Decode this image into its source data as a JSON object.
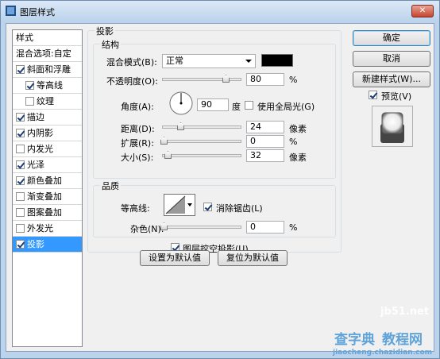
{
  "window": {
    "title": "图层样式",
    "close_glyph": "✕"
  },
  "stylelist": {
    "header": "样式",
    "blend_options": "混合选项:自定",
    "items": [
      {
        "label": "斜面和浮雕",
        "checked": true
      },
      {
        "label": "等高线",
        "checked": true
      },
      {
        "label": "纹理",
        "checked": false
      },
      {
        "label": "描边",
        "checked": true
      },
      {
        "label": "内阴影",
        "checked": true
      },
      {
        "label": "内发光",
        "checked": false
      },
      {
        "label": "光泽",
        "checked": true
      },
      {
        "label": "颜色叠加",
        "checked": true
      },
      {
        "label": "渐变叠加",
        "checked": false
      },
      {
        "label": "图案叠加",
        "checked": false
      },
      {
        "label": "外发光",
        "checked": false
      },
      {
        "label": "投影",
        "checked": true,
        "selected": true
      }
    ]
  },
  "shadow": {
    "group_title": "投影",
    "structure": {
      "title": "结构",
      "blend_mode_label": "混合模式(B):",
      "blend_mode_value": "正常",
      "shadow_color": "#000000",
      "opacity_label": "不透明度(O):",
      "opacity_value": "80",
      "opacity_level": 0.8,
      "opacity_unit": "%",
      "angle_label": "角度(A):",
      "angle_value": "90",
      "angle_unit": "度",
      "global_light_label": "使用全局光(G)",
      "global_light_checked": false,
      "distance_label": "距离(D):",
      "distance_value": "24",
      "distance_unit": "像素",
      "spread_label": "扩展(R):",
      "spread_value": "0",
      "spread_unit": "%",
      "size_label": "大小(S):",
      "size_value": "32",
      "size_unit": "像素"
    },
    "quality": {
      "title": "品质",
      "contour_label": "等高线:",
      "antialias_label": "消除锯齿(L)",
      "antialias_checked": true,
      "noise_label": "杂色(N):",
      "noise_value": "0",
      "noise_unit": "%"
    },
    "knockout_label": "图层挖空投影(U)",
    "knockout_checked": true,
    "make_default_label": "设置为默认值",
    "reset_default_label": "复位为默认值"
  },
  "actions": {
    "ok_label": "确定",
    "cancel_label": "取消",
    "new_style_label": "新建样式(W)...",
    "preview_label": "预览(V)",
    "preview_checked": true
  },
  "watermarks": {
    "site": "jb51.net",
    "brand": "查字典",
    "brand_suffix": "教程网",
    "url": "jiaocheng.chazidian.com"
  }
}
